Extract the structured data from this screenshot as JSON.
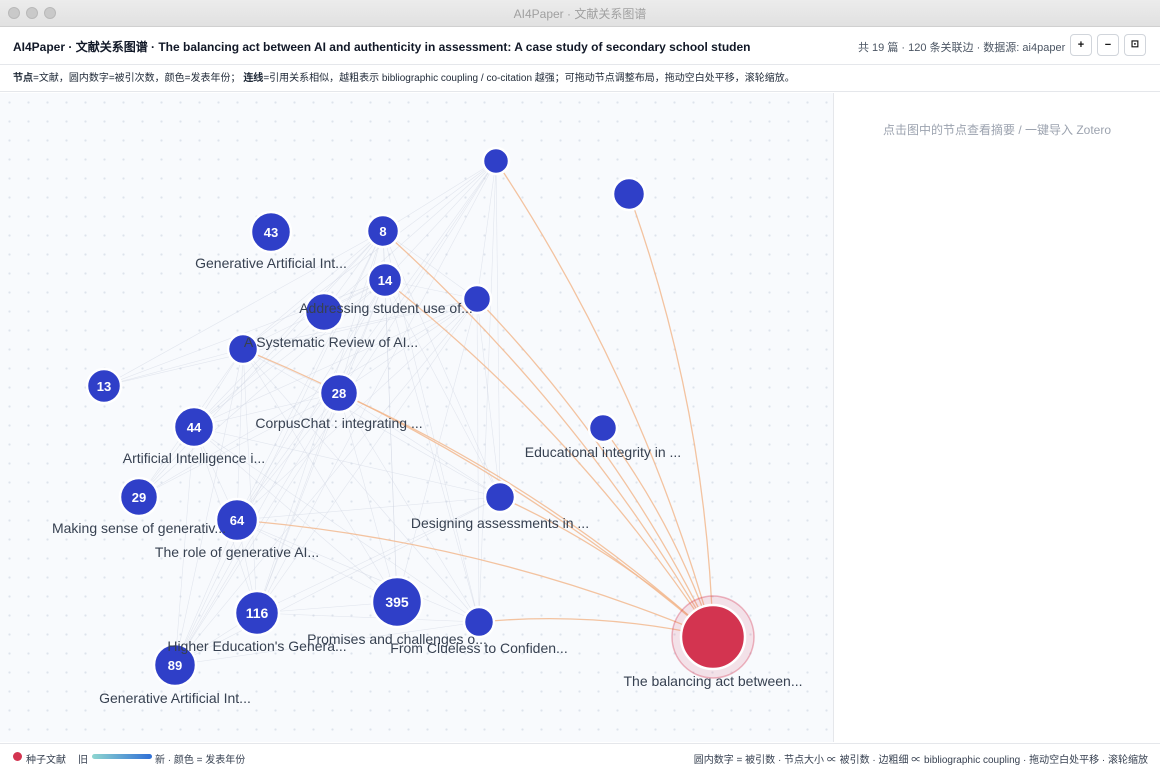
{
  "window": {
    "title": "AI4Paper · 文献关系图谱"
  },
  "header": {
    "title": "AI4Paper · 文献关系图谱 · The balancing act between AI and authenticity in assessment: A case study of secondary school studen",
    "stats": "共 19 篇 · 120 条关联边 · 数据源: ai4paper",
    "zoom_in": "+",
    "zoom_out": "−",
    "fit": "⊡"
  },
  "legend": {
    "nodes_key": "节点",
    "nodes_text": "=文献，圆内数字=被引次数，颜色=发表年份；",
    "edges_key": "连线",
    "edges_text": "=引用关系相似，越粗表示 bibliographic coupling / co-citation 越强；可拖动节点调整布局，拖动空白处平移，滚轮缩放。"
  },
  "side_panel": {
    "hint": "点击图中的节点查看摘要 / 一键导入 Zotero"
  },
  "footer": {
    "seed_label": "种子文献",
    "old_label": "旧",
    "new_label": "新 · 颜色 = 发表年份",
    "help": "圆内数字 = 被引数 · 节点大小 ∝ 被引数 · 边粗细 ∝ bibliographic coupling · 拖动空白处平移 · 滚轮缩放"
  },
  "colors": {
    "node": "#2f3fc8",
    "seed": "#d33450",
    "seed_edge": "#f2b98f",
    "edge": "#cfd6e2"
  },
  "graph": {
    "nodes": [
      {
        "id": "n1",
        "citations": "",
        "label": "",
        "seed": false
      },
      {
        "id": "n2",
        "citations": "",
        "label": "",
        "seed": false
      },
      {
        "id": "n3",
        "citations": "43",
        "label": "Generative Artificial Int...",
        "seed": false
      },
      {
        "id": "n4",
        "citations": "8",
        "label": "",
        "seed": false
      },
      {
        "id": "n5",
        "citations": "14",
        "label": "",
        "seed": false
      },
      {
        "id": "n6",
        "citations": "",
        "label": "Addressing student use of...",
        "seed": false
      },
      {
        "id": "n7",
        "citations": "",
        "label": "",
        "seed": false
      },
      {
        "id": "n8",
        "citations": "",
        "label": "A Systematic Review of AI...",
        "seed": false
      },
      {
        "id": "n9",
        "citations": "13",
        "label": "",
        "seed": false
      },
      {
        "id": "n10",
        "citations": "28",
        "label": "CorpusChat : integrating ...",
        "seed": false
      },
      {
        "id": "n11",
        "citations": "44",
        "label": "Artificial Intelligence i...",
        "seed": false
      },
      {
        "id": "n12",
        "citations": "",
        "label": "Educational integrity in ...",
        "seed": false
      },
      {
        "id": "n13",
        "citations": "29",
        "label": "Making sense of generativ...",
        "seed": false
      },
      {
        "id": "n14",
        "citations": "64",
        "label": "The role of generative AI...",
        "seed": false
      },
      {
        "id": "n15",
        "citations": "",
        "label": "Designing assessments in ...",
        "seed": false
      },
      {
        "id": "n16",
        "citations": "116",
        "label": "Higher Education's Genera...",
        "seed": false
      },
      {
        "id": "n17",
        "citations": "395",
        "label": "Promises and challenges o...",
        "seed": false
      },
      {
        "id": "n18",
        "citations": "",
        "label": "From Clueless to Confiden...",
        "seed": false
      },
      {
        "id": "n19",
        "citations": "89",
        "label": "Generative Artificial Int...",
        "seed": false
      },
      {
        "id": "seed",
        "citations": "",
        "label": "The balancing act between...",
        "seed": true
      }
    ]
  }
}
